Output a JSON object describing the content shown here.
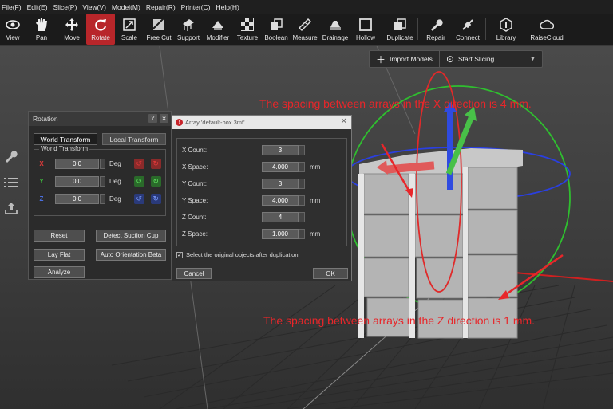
{
  "menu": [
    "File(F)",
    "Edit(E)",
    "Slice(P)",
    "View(V)",
    "Model(M)",
    "Repair(R)",
    "Printer(C)",
    "Help(H)"
  ],
  "toolbar": [
    {
      "label": "View",
      "icon": "eye-icon"
    },
    {
      "label": "Pan",
      "icon": "hand-icon"
    },
    {
      "label": "Move",
      "icon": "move-icon"
    },
    {
      "label": "Rotate",
      "icon": "rotate-icon",
      "active": true
    },
    {
      "label": "Scale",
      "icon": "scale-icon"
    },
    {
      "label": "Free Cut",
      "icon": "cut-icon"
    },
    {
      "label": "Support",
      "icon": "support-icon"
    },
    {
      "label": "Modifier",
      "icon": "modifier-icon"
    },
    {
      "label": "Texture",
      "icon": "texture-icon"
    },
    {
      "label": "Boolean",
      "icon": "boolean-icon"
    },
    {
      "label": "Measure",
      "icon": "ruler-icon"
    },
    {
      "label": "Drainage",
      "icon": "drainage-icon"
    },
    {
      "label": "Hollow",
      "icon": "hollow-icon"
    },
    {
      "label": "Duplicate",
      "icon": "duplicate-icon"
    },
    {
      "label": "Repair",
      "icon": "wrench-icon"
    },
    {
      "label": "Connect",
      "icon": "connect-icon"
    },
    {
      "label": "Library",
      "icon": "library-icon"
    },
    {
      "label": "RaiseCloud",
      "icon": "cloud-icon"
    }
  ],
  "top_buttons": {
    "import": "Import Models",
    "slice": "Start Slicing"
  },
  "rotation_panel": {
    "title": "Rotation",
    "help": "?",
    "close": "✕",
    "tabs": [
      "World Transform",
      "Local Transform"
    ],
    "group_label": "World Transform",
    "axes": [
      {
        "axis": "X",
        "value": "0.0",
        "unit": "Deg",
        "color": "#e23a3a"
      },
      {
        "axis": "Y",
        "value": "0.0",
        "unit": "Deg",
        "color": "#3fbf3f"
      },
      {
        "axis": "Z",
        "value": "0.0",
        "unit": "Deg",
        "color": "#4a6fe0"
      }
    ],
    "buttons": {
      "reset": "Reset",
      "suction": "Detect Suction Cup",
      "lay_flat": "Lay Flat",
      "auto_orient": "Auto Orientation Beta",
      "analyze": "Analyze"
    }
  },
  "array_dialog": {
    "title": "Array 'default-box.3mf'",
    "fields": [
      {
        "label": "X Count:",
        "value": "3",
        "unit": ""
      },
      {
        "label": "X Space:",
        "value": "4.000",
        "unit": "mm"
      },
      {
        "label": "Y Count:",
        "value": "3",
        "unit": ""
      },
      {
        "label": "Y Space:",
        "value": "4.000",
        "unit": "mm"
      },
      {
        "label": "Z Count:",
        "value": "4",
        "unit": ""
      },
      {
        "label": "Z Space:",
        "value": "1.000",
        "unit": "mm"
      }
    ],
    "checkbox_label": "Select the original objects after duplication",
    "checkbox_checked": true,
    "cancel": "Cancel",
    "ok": "OK"
  },
  "annotations": {
    "x_spacing": "The spacing between arrays in the X direction is 4 mm.",
    "z_spacing": "The spacing between arrays in the Z direction is 1 mm."
  },
  "colors": {
    "accent": "#b8262a",
    "annotation": "#e8262a",
    "x_axis": "#e23a3a",
    "y_axis": "#3fbf3f",
    "z_axis": "#4a6fe0"
  }
}
